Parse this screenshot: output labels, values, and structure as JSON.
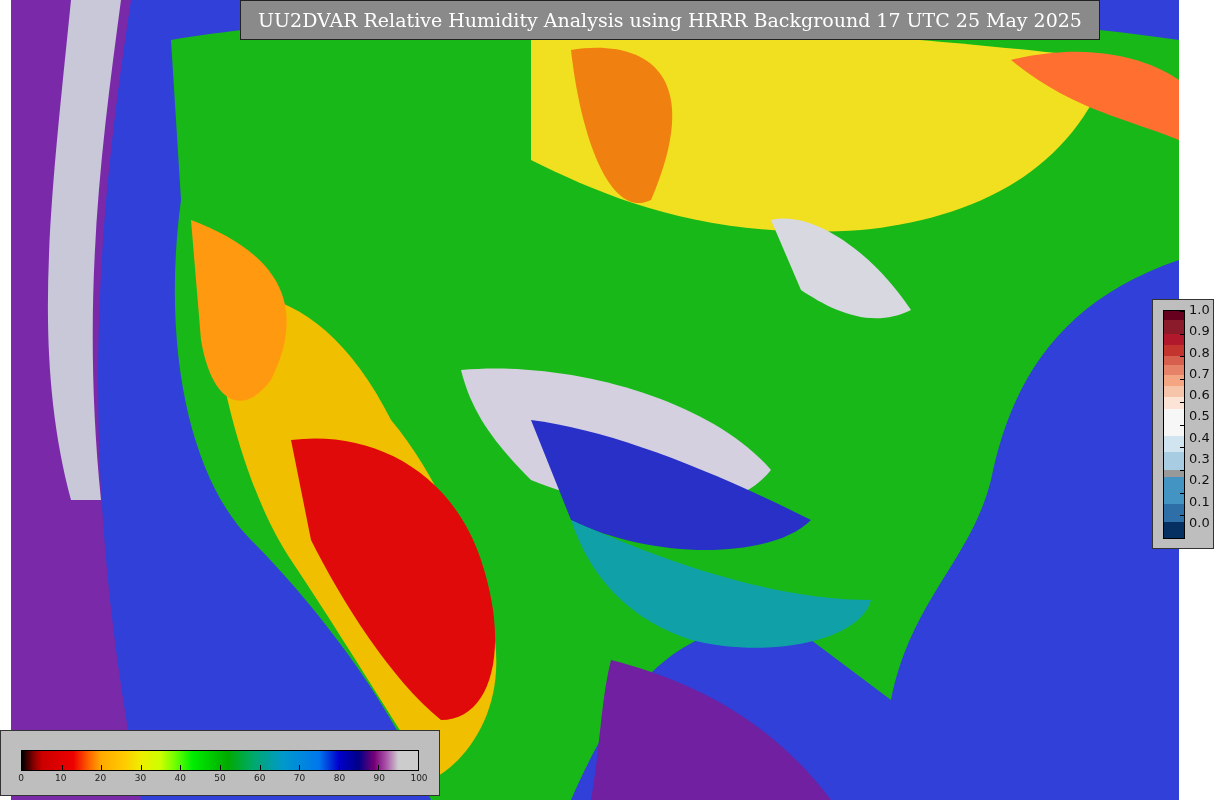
{
  "title": "UU2DVAR Relative Humidity Analysis using HRRR Background 17 UTC 25 May 2025",
  "side_colorbar": {
    "ticks": [
      "1.0",
      "0.9",
      "0.8",
      "0.7",
      "0.6",
      "0.5",
      "0.4",
      "0.3",
      "0.2",
      "0.1",
      "0.0"
    ]
  },
  "bottom_colorbar": {
    "ticks": [
      "0",
      "10",
      "20",
      "30",
      "40",
      "50",
      "60",
      "70",
      "80",
      "90",
      "100"
    ]
  }
}
